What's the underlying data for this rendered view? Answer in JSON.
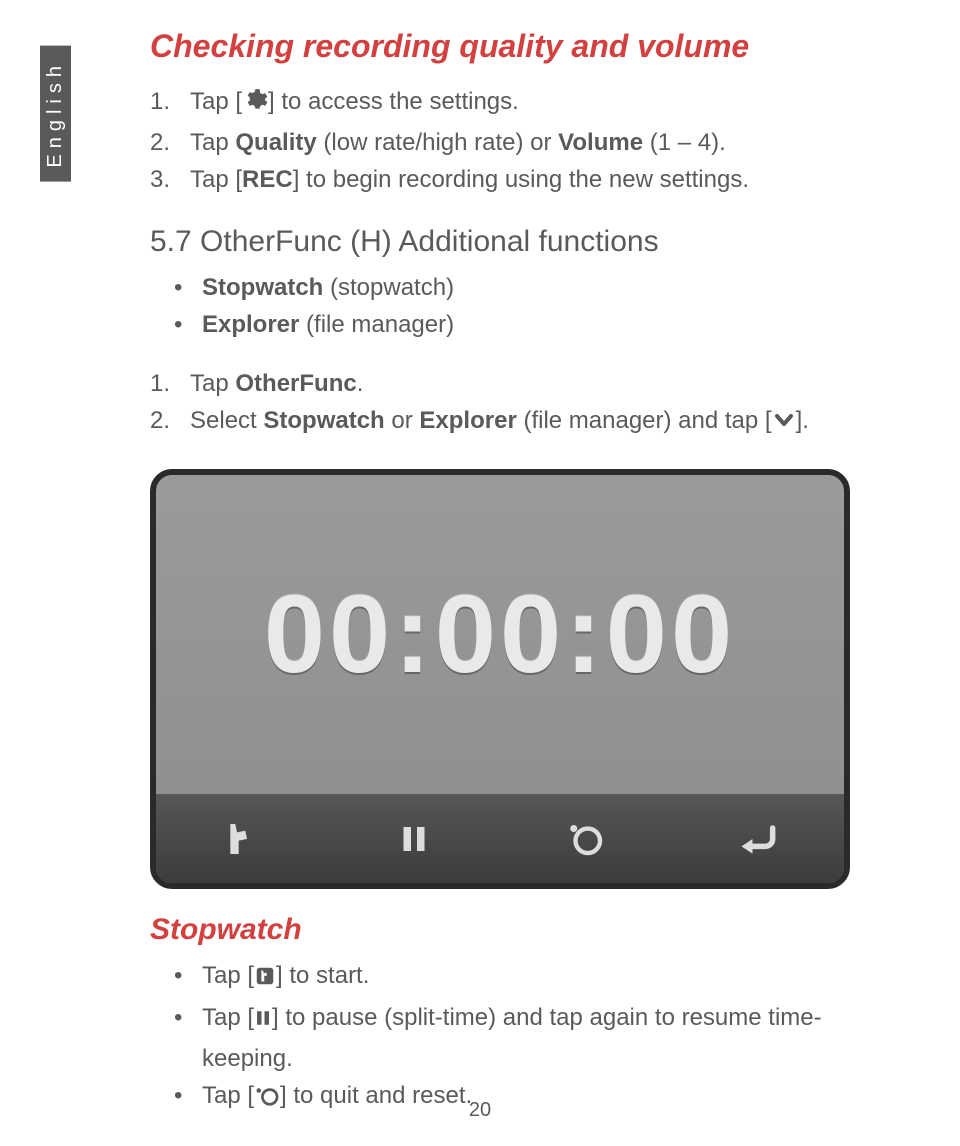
{
  "language_tab": "English",
  "page_number": "20",
  "heading1": "Checking recording quality and volume",
  "steps1": [
    {
      "num": "1.",
      "pre": "Tap [",
      "icon": "settings-gear-icon",
      "post": "] to access the settings."
    },
    {
      "num": "2.",
      "pre": "Tap ",
      "bold1": "Quality",
      "mid1": " (low rate/high rate) or ",
      "bold2": "Volume",
      "post": " (1 – 4)."
    },
    {
      "num": "3.",
      "pre": "Tap [",
      "rec": "REC",
      "post": "] to begin recording using the new settings."
    }
  ],
  "section_title": "5.7 OtherFunc (H) Additional functions",
  "section_bullets": [
    {
      "bold": "Stopwatch",
      "post": " (stopwatch)"
    },
    {
      "bold": "Explorer",
      "post": " (file manager)"
    }
  ],
  "steps2": [
    {
      "num": "1.",
      "pre": "Tap ",
      "bold1": "OtherFunc",
      "post": "."
    },
    {
      "num": "2.",
      "pre": "Select ",
      "bold1": "Stopwatch",
      "mid1": " or ",
      "bold2": "Explorer",
      "mid2": " (file manager) and tap [",
      "icon": "chevron-down-icon",
      "post": "]."
    }
  ],
  "device": {
    "time": "00:00:00",
    "buttons": [
      "start-flag-icon",
      "pause-icon",
      "reset-circle-icon",
      "return-icon"
    ]
  },
  "stopwatch_heading": "Stopwatch",
  "stopwatch_bullets": [
    {
      "pre": "Tap [",
      "icon": "start-flag-icon",
      "post": "] to start."
    },
    {
      "pre": "Tap [",
      "icon": "pause-bars-icon",
      "post": "] to pause (split-time) and tap again to resume time-keeping."
    },
    {
      "pre": "Tap [",
      "icon": "reset-circle-dot-icon",
      "post": "] to quit and reset."
    }
  ]
}
